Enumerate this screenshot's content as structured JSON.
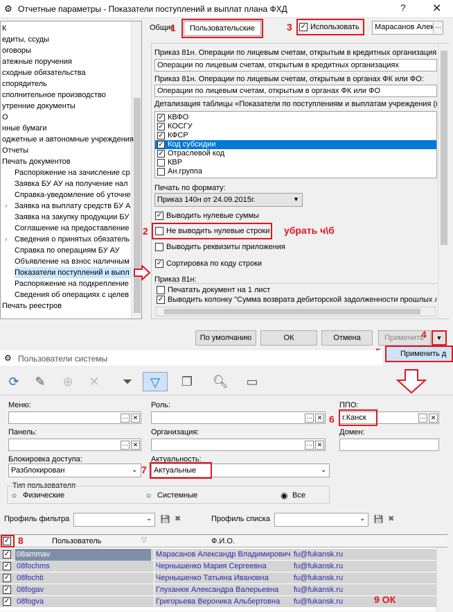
{
  "dialog1": {
    "title": "Отчетные параметры - Показатели поступлений и выплат плана ФХД",
    "tabs": {
      "general": "Общие",
      "custom": "Пользовательские"
    },
    "use_label": "Использовать",
    "user_combo": "Марасанов Алек",
    "tree": [
      "К",
      "едиты, ссуды",
      "оговоры",
      "атежные поручения",
      "сходные обязательства",
      "спорядитель",
      "сполнительное производство",
      "утренние документы",
      "О",
      "нные бумаги",
      "оджетные и автономные учреждения",
      "Отчеты",
      "Печать документов",
      "Распоряжение на зачисление ср",
      "Заявка БУ АУ на получение нал",
      "Справка-уведомление об уточне",
      "Заявка на выплату средств БУ А",
      "Заявка на закупку продукции БУ",
      "Соглашение на предоставление",
      "Сведения о принятых обязатель",
      "Справка по операциям БУ АУ",
      "Объявление на взнос наличным",
      "Показатели поступлений и выпл",
      "Распоряжение на подкрепление",
      "Сведения об операциях с целев",
      "Печать реестров"
    ],
    "order81_1_label": "Приказ 81н. Операции по лицевым счетам, открытым в кредитных организация",
    "order81_1_value": "Операции по лицевым счетам, открытым в кредитных организациях",
    "order81_2_label": "Приказ 81н. Операции по лицевым счетам, открытым в органах ФК или ФО:",
    "order81_2_value": "Операции по лицевым счетам, открытым в органах ФК или ФО",
    "detail_label": "Детализация таблицы «Показатели по поступлениям и выплатам учреждения (г",
    "detail_items": [
      {
        "label": "КВФО",
        "checked": "✓"
      },
      {
        "label": "КОСГУ",
        "checked": "✓"
      },
      {
        "label": "КФСР",
        "checked": "✓"
      },
      {
        "label": "Код субсидии",
        "checked": "✓"
      },
      {
        "label": "Отраслевой код",
        "checked": "✓"
      },
      {
        "label": "КВР",
        "checked": ""
      },
      {
        "label": "Ан.группа",
        "checked": ""
      }
    ],
    "print_format_label": "Печать по формату:",
    "print_format_value": "Приказ 140н от 24.09.2015г.",
    "opt_zero_sums": "Выводить нулевые суммы",
    "opt_no_zero_rows": "Не выводить нулевые строки",
    "opt_requisites": "Выводить реквизиты приложения",
    "opt_sort": "Сортировка по коду строки",
    "order81_label": "Приказ 81н:",
    "opt_one_sheet": "Печатать документ на 1 лист",
    "opt_return_col": "Выводить колонку \"Сумма возврата дебиторской задолженности прошлых л",
    "annotation_remove": "убрать ч\\б",
    "buttons": {
      "default": "По умолчанию",
      "ok": "ОК",
      "cancel": "Отмена",
      "apply": "Применить",
      "apply_menu": "Применить д"
    }
  },
  "dialog2": {
    "title": "Пользователи системы",
    "menu_label": "Меню:",
    "role_label": "Роль:",
    "ppo_label": "ППО:",
    "ppo_value": "г.Канск",
    "panel_label": "Панель:",
    "org_label": "Организация:",
    "domain_label": "Домен:",
    "block_label": "Блокировка доступа:",
    "block_value": "Разблокирован",
    "actual_label": "Актуальность:",
    "actual_value": "Актуальные",
    "usertype_label": "Тип пользователя",
    "usertype_options": [
      "Физические",
      "Системные",
      "Все"
    ],
    "filter_profile": "Профиль фильтра",
    "list_profile": "Профиль списка",
    "col_user": "Пользователь",
    "col_fio": "Ф.И.О.",
    "rows": [
      {
        "user": "08ammav",
        "fio": "Марасанов Александр Владимирович",
        "email": "fu@fukansk.ru"
      },
      {
        "user": "08fochms",
        "fio": "Чернышенко Мария Сергеевна",
        "email": "fu@fukansk.ru"
      },
      {
        "user": "08fochti",
        "fio": "Чернышенко Татьяна Ивановна",
        "email": "fu@fukansk.ru"
      },
      {
        "user": "08fogav",
        "fio": "Глуханюк Александра Валерьевна",
        "email": "fu@fukansk.ru"
      },
      {
        "user": "08fogva",
        "fio": "Григорьева Вероника Альбертовна",
        "email": "fu@fukansk.ru"
      }
    ]
  },
  "markers": {
    "m1": "1",
    "m2": "2",
    "m3": "3",
    "m4": "4",
    "m5": "5",
    "m6": "6",
    "m7": "7",
    "m8": "8",
    "m9": "9 ОК"
  }
}
